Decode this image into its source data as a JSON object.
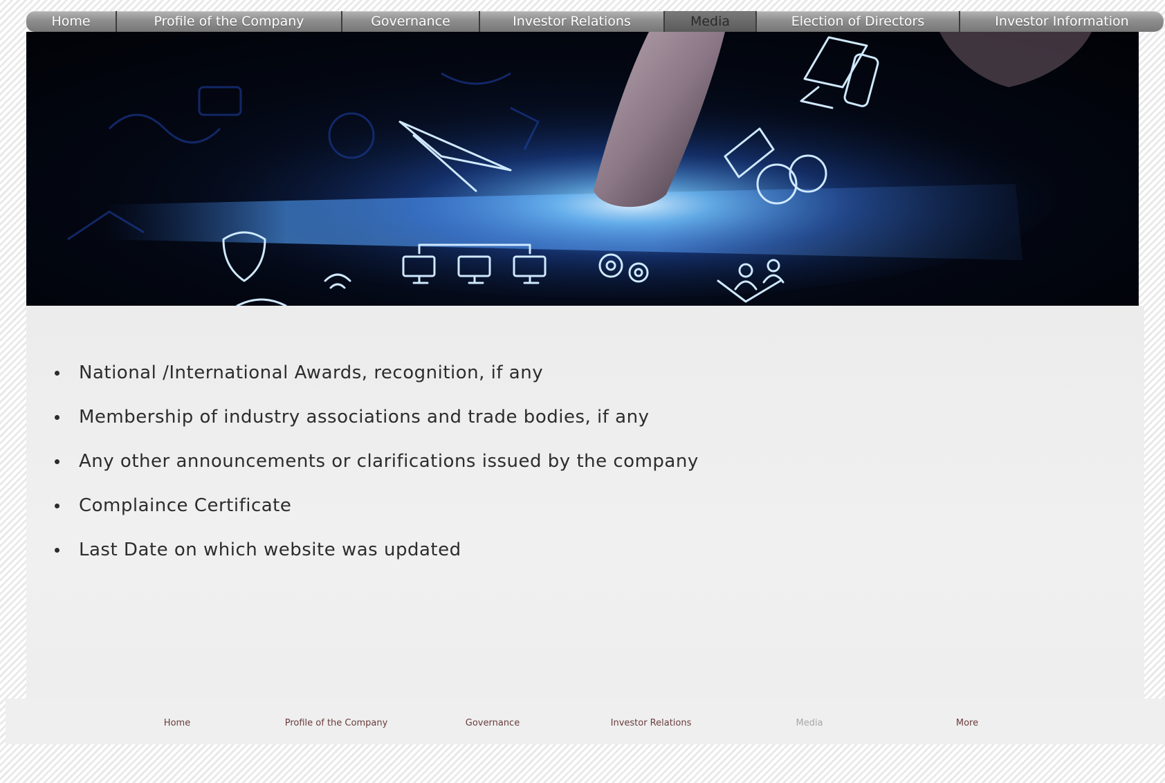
{
  "topnav": {
    "items": [
      {
        "label": "Home"
      },
      {
        "label": "Profile of the Company"
      },
      {
        "label": "Governance"
      },
      {
        "label": "Investor Relations"
      },
      {
        "label": "Media"
      },
      {
        "label": "Election of Directors"
      },
      {
        "label": "Investor Information"
      }
    ],
    "active": "Media"
  },
  "hero": {
    "icon": "digital-network-touch-banner"
  },
  "content": {
    "items": [
      {
        "text": "National /International Awards, recognition, if any"
      },
      {
        "text": "Membership of industry associations and trade bodies, if any"
      },
      {
        "text": "Any other announcements or clarifications issued by the company"
      },
      {
        "text": "Complaince Certificate"
      },
      {
        "text": "Last Date on which website was updated"
      }
    ]
  },
  "footer": {
    "items": [
      {
        "label": "Home"
      },
      {
        "label": "Profile of the Company"
      },
      {
        "label": "Governance"
      },
      {
        "label": "Investor Relations"
      },
      {
        "label": "Media"
      },
      {
        "label": "More"
      }
    ],
    "active": "Media"
  },
  "colors": {
    "nav_bg": "#8e8e8e",
    "nav_active": "#5a5a5a",
    "text": "#2c2c2c",
    "footer_link": "#6a3b3b",
    "footer_active": "#a7a7a7",
    "hero_glow": "#4aa8ff"
  }
}
